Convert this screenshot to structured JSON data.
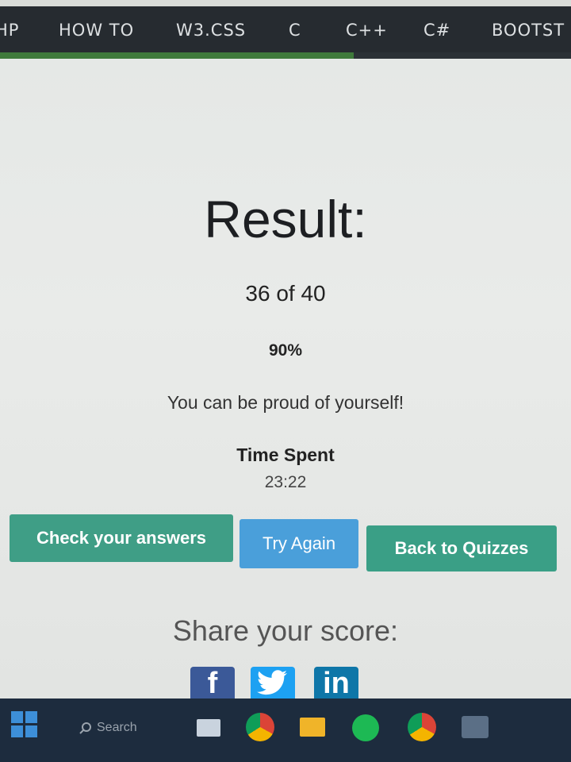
{
  "topnav": {
    "items": [
      "HP",
      "HOW TO",
      "W3.CSS",
      "C",
      "C++",
      "C#",
      "BOOTST"
    ]
  },
  "quiz_progress": 0.62,
  "result": {
    "title": "Result:",
    "score": "36 of 40",
    "percent": "90%",
    "message": "You can be proud of yourself!",
    "time_label": "Time Spent",
    "time_value": "23:22"
  },
  "buttons": {
    "check": "Check your answers",
    "try_again": "Try Again",
    "back": "Back to Quizzes"
  },
  "share": {
    "label": "Share your score:",
    "icons": [
      "facebook-icon",
      "twitter-icon",
      "linkedin-icon"
    ]
  },
  "taskbar": {
    "search_placeholder": "Search",
    "apps": [
      "start-icon",
      "search-icon",
      "task-view-icon",
      "chrome-icon",
      "file-explorer-icon",
      "spotify-icon",
      "chrome-profile-icon",
      "app-icon"
    ]
  },
  "colors": {
    "nav_bg": "#262b30",
    "progress": "#3f7a3b",
    "green_button": "#3f9e86",
    "blue_button": "#4a9fda"
  }
}
